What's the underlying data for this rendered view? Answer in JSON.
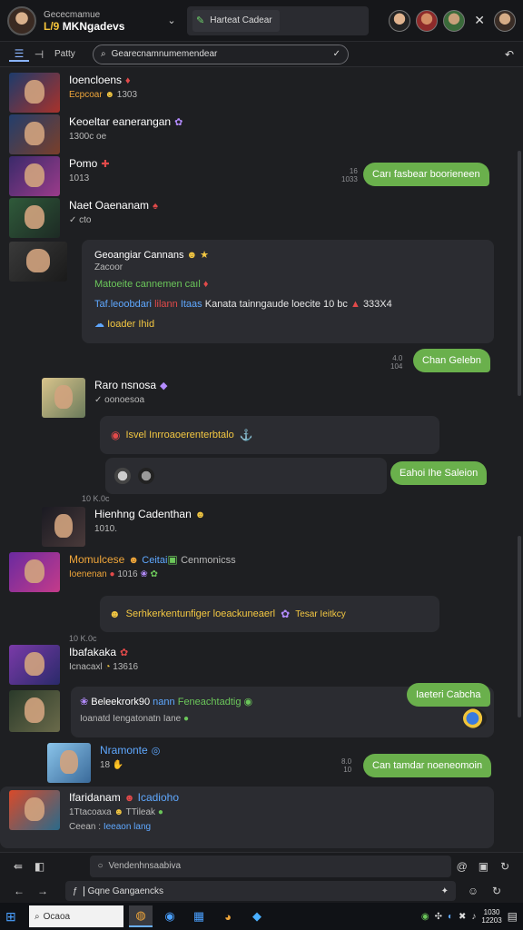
{
  "header": {
    "subtitle": "Gececmamue",
    "title_accent": "L/9",
    "title": "MKNgadevs",
    "search_pill": "Harteat Cadear",
    "close": "✕"
  },
  "toolbar": {
    "tab_label": "Patty",
    "search_value": "Gearecnamnumemendear",
    "check": "✓",
    "right_icon": "↶"
  },
  "feed": {
    "items": [
      {
        "name": "Ioencloens",
        "emo": "♦",
        "sub_a": "Ecpcoar",
        "sub_b": "1303"
      },
      {
        "name": "Keoeltar eanerangan",
        "emo": "✿",
        "sub": "1300c oe"
      },
      {
        "name": "Pomo",
        "emo": "✚",
        "sub": "1013"
      },
      {
        "name": "Naet Oaenanam",
        "emo": "♠",
        "sub": "✓ cto"
      },
      {
        "name": "Raro nsnosa",
        "emo": "◆",
        "sub": "✓ oonoesoa"
      },
      {
        "name": "Hienhng Cadenthan",
        "emo": "☻",
        "sub": "1010."
      },
      {
        "name": "Momulcese",
        "emo": "☻",
        "name_b": "Ceitai",
        "name_c": "Cenmonicss",
        "sub_a": "Ioenenan",
        "sub_b": "1016"
      },
      {
        "name": "Ibafakaka",
        "emo": "✿",
        "sub_a": "Icnacaxl",
        "sub_b": "13616"
      },
      {
        "name": "Nramonte",
        "emo": "◎",
        "sub": "18"
      },
      {
        "name": "Ifaridanam",
        "emo": "☻",
        "name_b": "Icadioho",
        "sub_a": "1Ttacoaxa",
        "sub_b": "TTileak",
        "sub_c": "Ceean",
        "sub_d": "Ieeaon lang"
      }
    ],
    "card1": {
      "title": "Geoangiar Cannans",
      "sub": "Zacoor",
      "line_green": "Matoeite cannemen caıl",
      "line_blue": "Taf.leoobdari",
      "line_red": "lilann",
      "line_b2": "Itaas",
      "line_white": "Kanata tainngaude loecite 10 bc",
      "line_tail": "333X4",
      "line_yellow": "Ioader",
      "line_yellow2": "Ihid"
    },
    "card2": {
      "line": "Isvel Inrroaoerenterbtalo"
    },
    "card3": {
      "text": "Serhkerkentunfiger loeackuneaerl",
      "tail": "Tesar Ieitkcy"
    },
    "card4": {
      "name": "Beleekrork90",
      "name_b": "nann",
      "name_c": "Feneachtadtig",
      "sub": "Ioanatd Iengatonatn",
      "sub_b": "Iane"
    },
    "bubbles": [
      {
        "text": "Carı fasbear boorieneen",
        "stamp1": "16",
        "stamp2": "1033"
      },
      {
        "text": "Chan Gelebn",
        "stamp1": "4.0",
        "stamp2": "104"
      },
      {
        "text": "Eahoi Ihe Saleion"
      },
      {
        "text": "Iaeteri Cabcha"
      },
      {
        "text": "Can tamdar noeneomoin",
        "stamp1": "8.0",
        "stamp2": "10"
      }
    ],
    "times": [
      "10 K.0c",
      "10 K.0c"
    ]
  },
  "footer": {
    "pane_input": "Vendenhnsaabiva",
    "message_input": "Gqne Gangaencks",
    "taskbar_search": "Ocaoa",
    "clock_time": "1030",
    "clock_date": "12203"
  }
}
